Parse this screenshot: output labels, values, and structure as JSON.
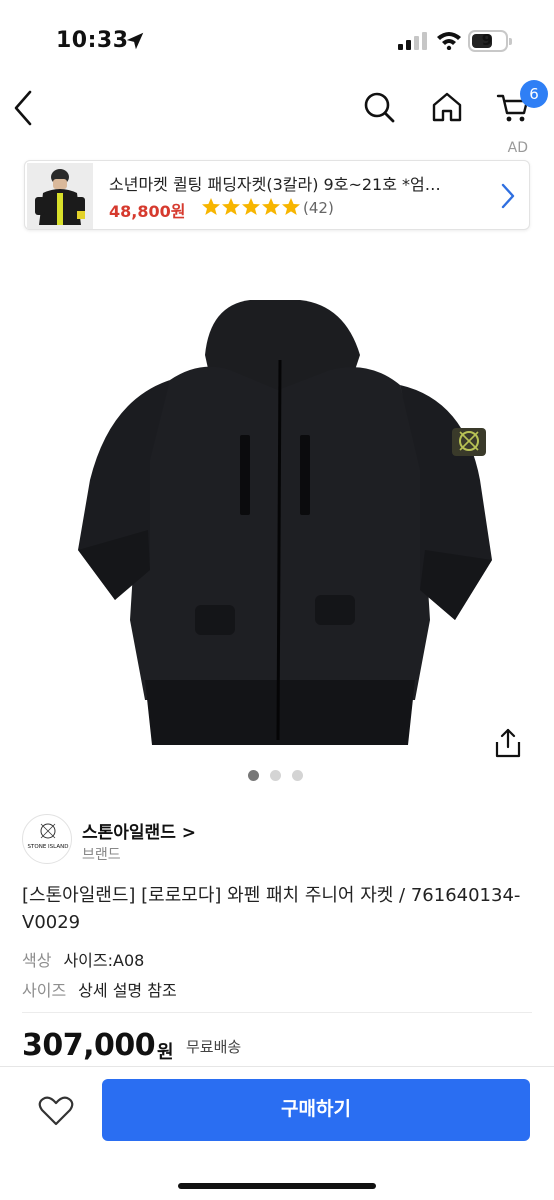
{
  "status": {
    "time": "10:33",
    "battery": "9"
  },
  "nav": {
    "cart_count": "6"
  },
  "ad": {
    "label": "AD",
    "title": "소년마켓 퀼팅 패딩자켓(3칼라) 9호~21호 *엄…",
    "price": "48,800원",
    "rating_stars": 5,
    "review_count": "(42)",
    "accent_color": "#d63a2e"
  },
  "gallery": {
    "image_count": 3,
    "active_index": 0
  },
  "brand": {
    "name": "스톤아일랜드 >",
    "sub": "브랜드",
    "logo_text": "STONE ISLAND"
  },
  "product": {
    "title": "[스톤아일랜드] [로로모다] 와펜 패치 주니어 자켓 / 761640134-V0029",
    "options": [
      {
        "key": "색상",
        "value": "사이즈:A08"
      },
      {
        "key": "사이즈",
        "value": "상세 설명 참조"
      }
    ],
    "price": "307,000",
    "price_unit": "원",
    "shipping": "무료배송"
  },
  "actions": {
    "buy_label": "구매하기",
    "buy_color": "#2a6ef2"
  }
}
